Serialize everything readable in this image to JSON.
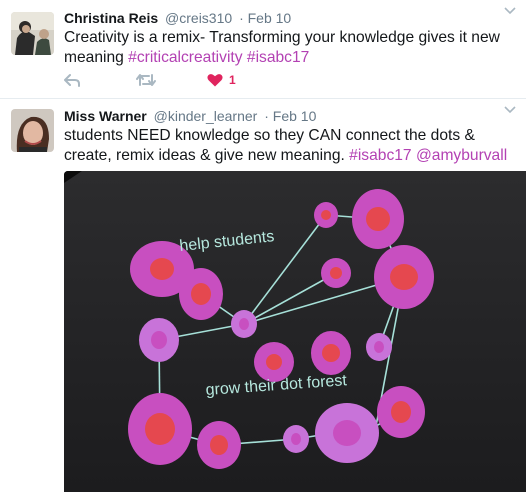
{
  "tweets": [
    {
      "name": "Christina Reis",
      "handle": "@creis310",
      "date": "· Feb 10",
      "text": "Creativity is a remix- Transforming your knowledge gives it new meaning ",
      "hashtags": [
        "#criticalcreativity",
        "#isabc17"
      ],
      "like_count": "1"
    },
    {
      "name": "Miss Warner",
      "handle": "@kinder_learner",
      "date": "· Feb 10",
      "text": "students NEED knowledge so they CAN connect the dots & create, remix ideas & give new meaning. ",
      "hashtags": [
        "#isabc17",
        "@amyburvall"
      ],
      "media": {
        "text_top": "help students",
        "text_bottom": "grow their dot forest"
      }
    }
  ],
  "colors": {
    "link": "#b341b3",
    "like": "#e0245e",
    "meta": "#657786"
  },
  "icons": [
    "chevron-down-icon",
    "reply-icon",
    "retweet-icon",
    "heart-icon"
  ]
}
